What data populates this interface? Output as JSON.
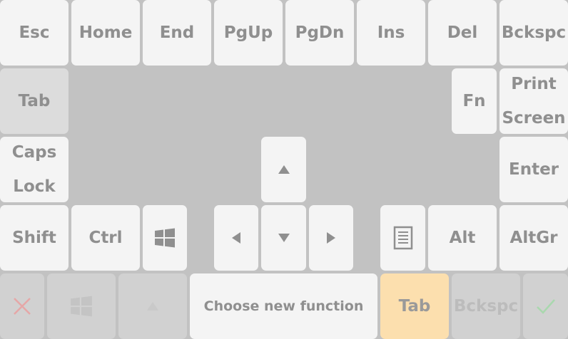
{
  "keyboard": {
    "row1": [
      "Esc",
      "Home",
      "End",
      "PgUp",
      "PgDn",
      "Ins",
      "Del",
      "Bckspc"
    ],
    "tab": "Tab",
    "fn": "Fn",
    "print_screen": "Print\nScreen",
    "caps_lock": "Caps\nLock",
    "enter": "Enter",
    "shift": "Shift",
    "ctrl": "Ctrl",
    "alt": "Alt",
    "altgr": "AltGr",
    "pressed_key": "Tab"
  },
  "bottom_bar": {
    "prompt": "Choose new function",
    "selected_key": "Tab",
    "recent_key": "Bckspc"
  },
  "colors": {
    "background": "#c2c2c2",
    "key": "#f4f4f4",
    "key_text": "#8f8f8f",
    "selected": "#fcdfae",
    "cancel": "#e6a7a7",
    "confirm": "#a9d8ae"
  }
}
